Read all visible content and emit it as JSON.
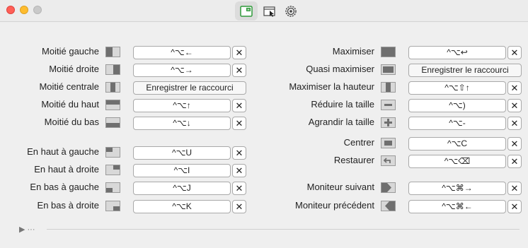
{
  "toolbar": {
    "tabs": [
      {
        "name": "keyboard-shortcuts",
        "icon": "keyboard-shortcut-icon",
        "active": true
      },
      {
        "name": "applications",
        "icon": "app-window-icon",
        "active": false
      },
      {
        "name": "settings",
        "icon": "gear-icon",
        "active": false
      }
    ]
  },
  "record_label": "Enregistrer le raccourci",
  "clear_glyph": "✕",
  "footer": {
    "disclosure": "▶ ···"
  },
  "left_rows": [
    {
      "label": "Moitié gauche",
      "shortcut": "^⌥←"
    },
    {
      "label": "Moitié droite",
      "shortcut": "^⌥→"
    },
    {
      "label": "Moitié centrale",
      "shortcut": ""
    },
    {
      "label": "Moitié du haut",
      "shortcut": "^⌥↑"
    },
    {
      "label": "Moitié du bas",
      "shortcut": "^⌥↓"
    },
    {
      "label": "En haut à gauche",
      "shortcut": "^⌥U"
    },
    {
      "label": "En haut à droite",
      "shortcut": "^⌥I"
    },
    {
      "label": "En bas à gauche",
      "shortcut": "^⌥J"
    },
    {
      "label": "En bas à droite",
      "shortcut": "^⌥K"
    }
  ],
  "right_rows": [
    {
      "label": "Maximiser",
      "shortcut": "^⌥↩"
    },
    {
      "label": "Quasi maximiser",
      "shortcut": ""
    },
    {
      "label": "Maximiser la hauteur",
      "shortcut": "^⌥⇧↑"
    },
    {
      "label": "Réduire la taille",
      "shortcut": "^⌥)"
    },
    {
      "label": "Agrandir la taille",
      "shortcut": "^⌥-"
    },
    {
      "label": "Centrer",
      "shortcut": "^⌥C"
    },
    {
      "label": "Restaurer",
      "shortcut": "^⌥⌫"
    },
    {
      "label": "Moniteur suivant",
      "shortcut": "^⌥⌘→"
    },
    {
      "label": "Moniteur précédent",
      "shortcut": "^⌥⌘←"
    }
  ]
}
